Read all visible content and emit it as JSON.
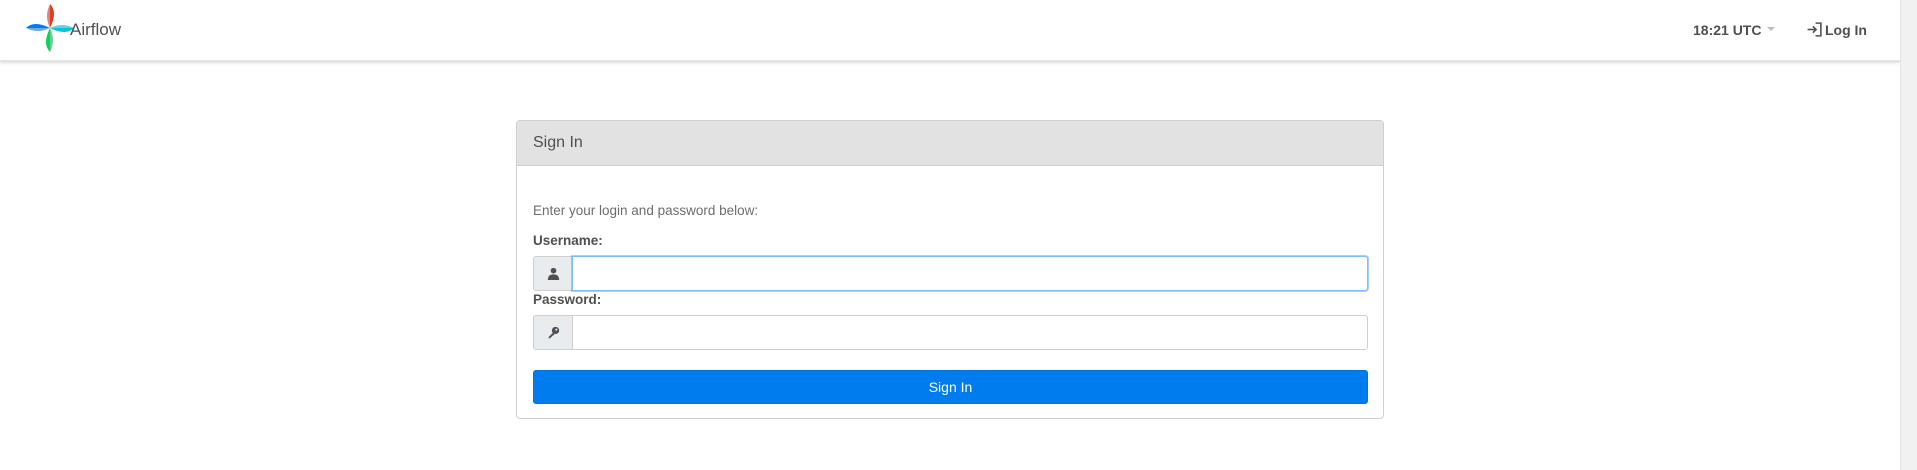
{
  "navbar": {
    "brand_name": "Airflow",
    "logo_icon": "airflow-pinwheel-logo",
    "clock": "18:21 UTC",
    "login_label": "Log In",
    "login_icon": "sign-in-icon"
  },
  "signin_card": {
    "title": "Sign In",
    "instructions": "Enter your login and password below:",
    "username": {
      "label": "Username:",
      "value": "",
      "placeholder": "",
      "icon": "user-icon"
    },
    "password": {
      "label": "Password:",
      "value": "",
      "placeholder": "",
      "icon": "key-icon"
    },
    "submit_label": "Sign In"
  },
  "colors": {
    "accent": "#017cee",
    "header_bg": "#e2e2e2",
    "text": "#51504f",
    "logo_red": "#e43921",
    "logo_blue": "#00ad46",
    "logo_green": "#04d659",
    "logo_cyan": "#00c7d4",
    "logo_navy": "#017cee"
  }
}
